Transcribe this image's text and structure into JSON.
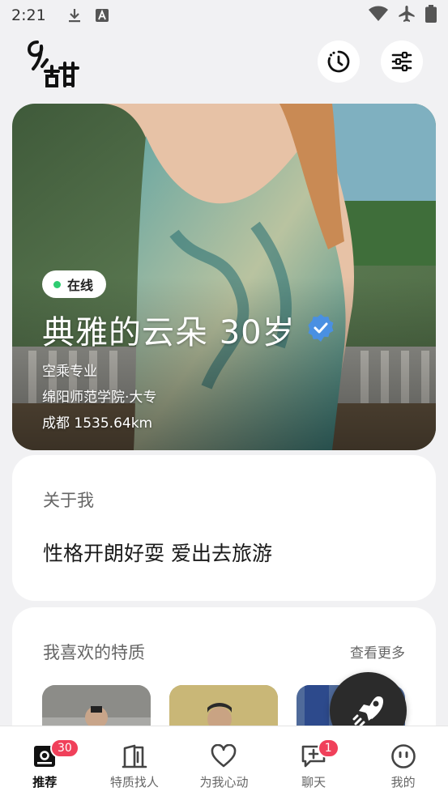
{
  "status_bar": {
    "time": "2:21",
    "left_icons": [
      "download-icon",
      "a-box-icon"
    ],
    "right_icons": [
      "wifi-icon",
      "airplane-icon",
      "battery-icon"
    ]
  },
  "header": {
    "logo_text": "9甜",
    "buttons": [
      "history-icon",
      "filter-icon"
    ]
  },
  "profile": {
    "status": "在线",
    "status_color": "#2ecc71",
    "name_age": "典雅的云朵 30岁",
    "verified_color": "#4a90e2",
    "major": "空乘专业",
    "school": "绵阳师范学院·大专",
    "location_distance": "成都 1535.64km"
  },
  "about": {
    "title": "关于我",
    "text": "性格开朗好耍 爱出去旅游"
  },
  "traits": {
    "title": "我喜欢的特质",
    "see_more": "查看更多"
  },
  "bottom_nav": [
    {
      "label": "推荐",
      "icon": "recommend-icon",
      "badge": "30",
      "active": true
    },
    {
      "label": "特质找人",
      "icon": "door-icon",
      "badge": "",
      "active": false
    },
    {
      "label": "为我心动",
      "icon": "heart-icon",
      "badge": "",
      "active": false
    },
    {
      "label": "聊天",
      "icon": "chat-icon",
      "badge": "1",
      "active": false
    },
    {
      "label": "我的",
      "icon": "face-icon",
      "badge": "",
      "active": false
    }
  ],
  "colors": {
    "badge": "#f0405a",
    "accent_dark": "#2b2b2b",
    "background": "#f1f1f3"
  }
}
